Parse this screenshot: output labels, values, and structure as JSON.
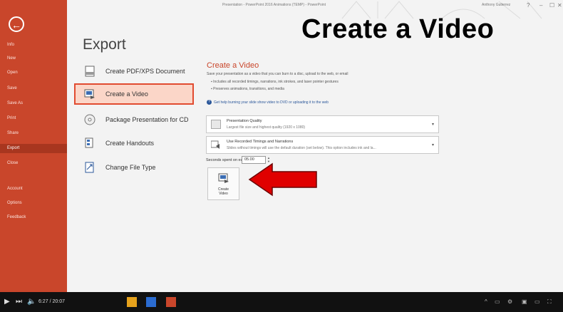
{
  "window": {
    "title": "Presentation - PowerPoint 2016 Animations (TEMP) - PowerPoint",
    "user": "Anthony Gutierrez",
    "controls": [
      "?",
      "–",
      "☐",
      "✕"
    ]
  },
  "overlay_title": "Create a Video",
  "sidebar": {
    "back_icon": "arrow-left-icon",
    "items": [
      {
        "label": "Info"
      },
      {
        "label": "New"
      },
      {
        "label": "Open"
      },
      {
        "label": "Save"
      },
      {
        "label": "Save As"
      },
      {
        "label": "Print"
      },
      {
        "label": "Share"
      },
      {
        "label": "Export",
        "active": true
      },
      {
        "label": "Close"
      },
      {
        "label": "Account"
      },
      {
        "label": "Options"
      },
      {
        "label": "Feedback"
      }
    ]
  },
  "export": {
    "heading": "Export",
    "options": [
      {
        "label": "Create PDF/XPS Document",
        "icon": "pdf-document-icon"
      },
      {
        "label": "Create a Video",
        "icon": "video-icon",
        "selected": true
      },
      {
        "label": "Package Presentation for CD",
        "icon": "disc-icon"
      },
      {
        "label": "Create Handouts",
        "icon": "handouts-icon"
      },
      {
        "label": "Change File Type",
        "icon": "file-type-icon"
      }
    ]
  },
  "panel": {
    "title": "Create a Video",
    "description": "Save your presentation as a video that you can burn to a disc, upload to the web, or email",
    "bullets": [
      "Includes all recorded timings, narrations, ink strokes, and laser pointer gestures",
      "Preserves animations, transitions, and media"
    ],
    "help_link": "Get help burning your slide show video to DVD or uploading it to the web",
    "quality": {
      "title": "Presentation Quality",
      "subtitle": "Largest file size and highest quality (1920 x 1080)"
    },
    "timings": {
      "title": "Use Recorded Timings and Narrations",
      "subtitle": "Slides without timings will use the default duration (set below). This option includes ink and la..."
    },
    "seconds_label": "Seconds spent on each slide:",
    "seconds_value": "05.00",
    "create_button": [
      "Create",
      "Video"
    ]
  },
  "player": {
    "time": "6:27 / 20:07",
    "progress": 0.32
  },
  "colors": {
    "accent": "#c9462b",
    "selected_bg": "#fbd6c8",
    "arrow": "#e00000"
  }
}
